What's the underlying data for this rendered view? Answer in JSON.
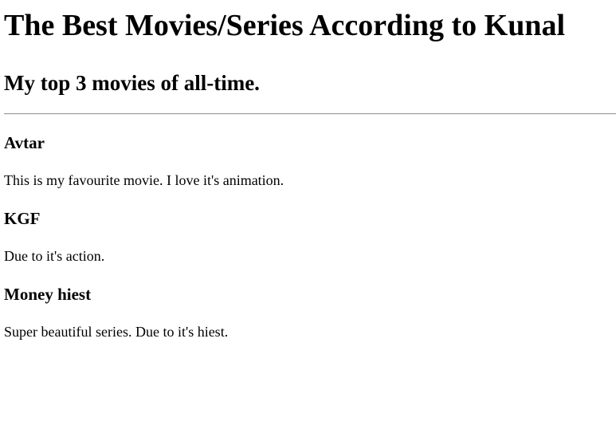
{
  "page": {
    "title": "The Best Movies/Series According to Kunal",
    "subtitle": "My top 3 movies of all-time."
  },
  "entries": [
    {
      "title": "Avtar",
      "description": "This is my favourite movie. I love it's animation."
    },
    {
      "title": "KGF",
      "description": "Due to it's action."
    },
    {
      "title": "Money hiest",
      "description": "Super beautiful series. Due to it's hiest."
    }
  ]
}
